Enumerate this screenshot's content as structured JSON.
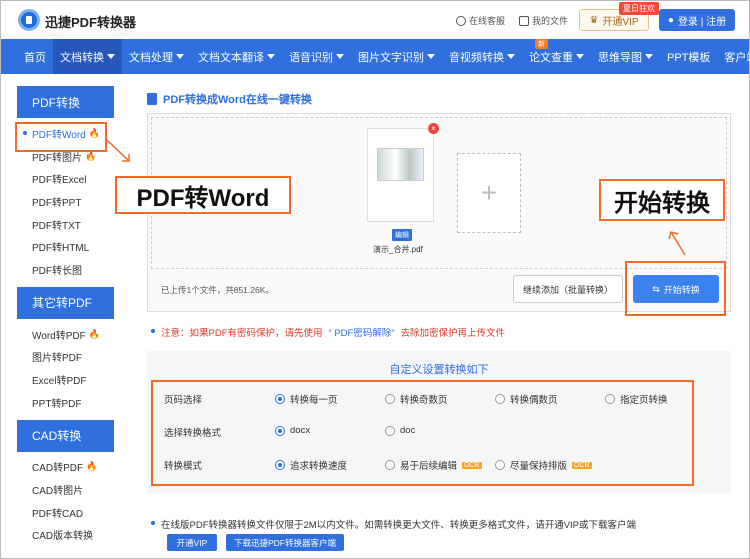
{
  "header": {
    "logo_text": "迅捷PDF转换器",
    "links": [
      "在线客服",
      "我的文件"
    ],
    "vip_label": "开通VIP",
    "vip_badge": "夏日狂欢",
    "login_label": "登录 | 注册"
  },
  "nav": {
    "items": [
      "首页",
      "文档转换",
      "文档处理",
      "文档文本翻译",
      "语音识别",
      "图片文字识别",
      "音视频转换",
      "论文查重",
      "思维导图",
      "PPT模板",
      "客户端"
    ],
    "new_badge": "新"
  },
  "sidebar": {
    "groups": [
      {
        "title": "PDF转换",
        "items": [
          "PDF转Word",
          "PDF转图片",
          "PDF转Excel",
          "PDF转PPT",
          "PDF转TXT",
          "PDF转HTML",
          "PDF转长图"
        ]
      },
      {
        "title": "其它转PDF",
        "items": [
          "Word转PDF",
          "图片转PDF",
          "Excel转PDF",
          "PPT转PDF"
        ]
      },
      {
        "title": "CAD转换",
        "items": [
          "CAD转PDF",
          "CAD转图片",
          "PDF转CAD",
          "CAD版本转换"
        ]
      }
    ]
  },
  "main": {
    "title": "PDF转换成Word在线一键转换",
    "file": {
      "edit_tag": "编辑",
      "name": "演示_合并.pdf"
    },
    "upload_info": "已上传1个文件，共851.26K。",
    "continue_label": "继续添加（批量转换）",
    "start_label": "开始转换",
    "notice_prefix": "注意：如果PDF有密码保护，请先使用",
    "notice_link": "“ PDF密码解除”",
    "notice_suffix": "去除加密保护再上传文件",
    "settings_title": "自定义设置转换如下",
    "settings": {
      "page_label": "页码选择",
      "page_options": [
        "转换每一页",
        "转换奇数页",
        "转换偶数页",
        "指定页转换"
      ],
      "format_label": "选择转换格式",
      "format_options": [
        "docx",
        "doc"
      ],
      "mode_label": "转换模式",
      "mode_options": [
        "追求转换速度",
        "易于后续编辑",
        "尽量保持排版"
      ],
      "ocr": "OCR"
    },
    "footer_note": "在线版PDF转换器转换文件仅限于2M以内文件。如需转换更大文件、转换更多格式文件，请开通VIP或下载客户端",
    "open_vip": "开通VIP",
    "download_client": "下载迅捷PDF转换器客户端"
  },
  "annotations": {
    "label_pdfword": "PDF转Word",
    "label_start": "开始转换",
    "accent": "#f26b2a"
  }
}
